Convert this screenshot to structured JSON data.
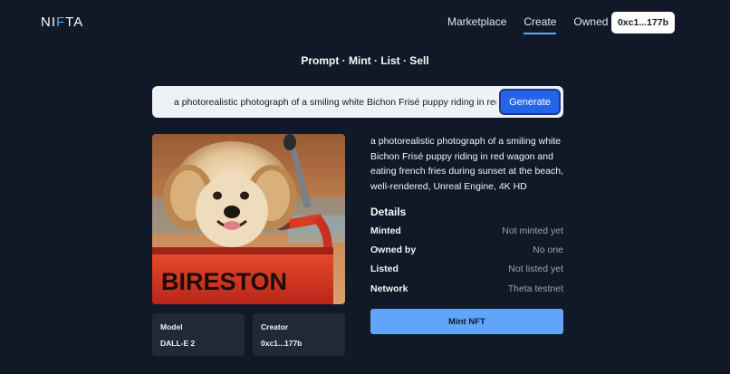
{
  "header": {
    "logo_text_1": "NI",
    "logo_text_2": "F",
    "logo_text_3": "TA",
    "nav": [
      {
        "label": "Marketplace"
      },
      {
        "label": "Create"
      },
      {
        "label": "Owned"
      }
    ],
    "wallet_label": "0xc1...177b"
  },
  "page_title": "Prompt · Mint · List · Sell",
  "prompt": {
    "value": "a photorealistic photograph of a smiling white Bichon Frisé puppy riding in red wagon and eating french fries during sunset at the beach, well-rendered, Unreal Engine, 4K HD",
    "generate_label": "Generate"
  },
  "image": {
    "wagon_text": "BIRESTON"
  },
  "cards": {
    "model_label": "Model",
    "model_value": "DALL-E 2",
    "creator_label": "Creator",
    "creator_value": "0xc1...177b"
  },
  "description": "a photorealistic photograph of a smiling white Bichon Frisé puppy riding in red wagon and eating french fries during sunset at the beach, well-rendered, Unreal Engine, 4K HD",
  "details": {
    "heading": "Details",
    "rows": [
      {
        "key": "Minted",
        "value": "Not minted yet"
      },
      {
        "key": "Owned by",
        "value": "No one"
      },
      {
        "key": "Listed",
        "value": "Not listed yet"
      },
      {
        "key": "Network",
        "value": "Theta testnet"
      }
    ]
  },
  "mint_label": "Mint NFT",
  "colors": {
    "background": "#111827",
    "accent": "#60a5fa",
    "generate": "#2563eb",
    "card": "#1f2937"
  }
}
